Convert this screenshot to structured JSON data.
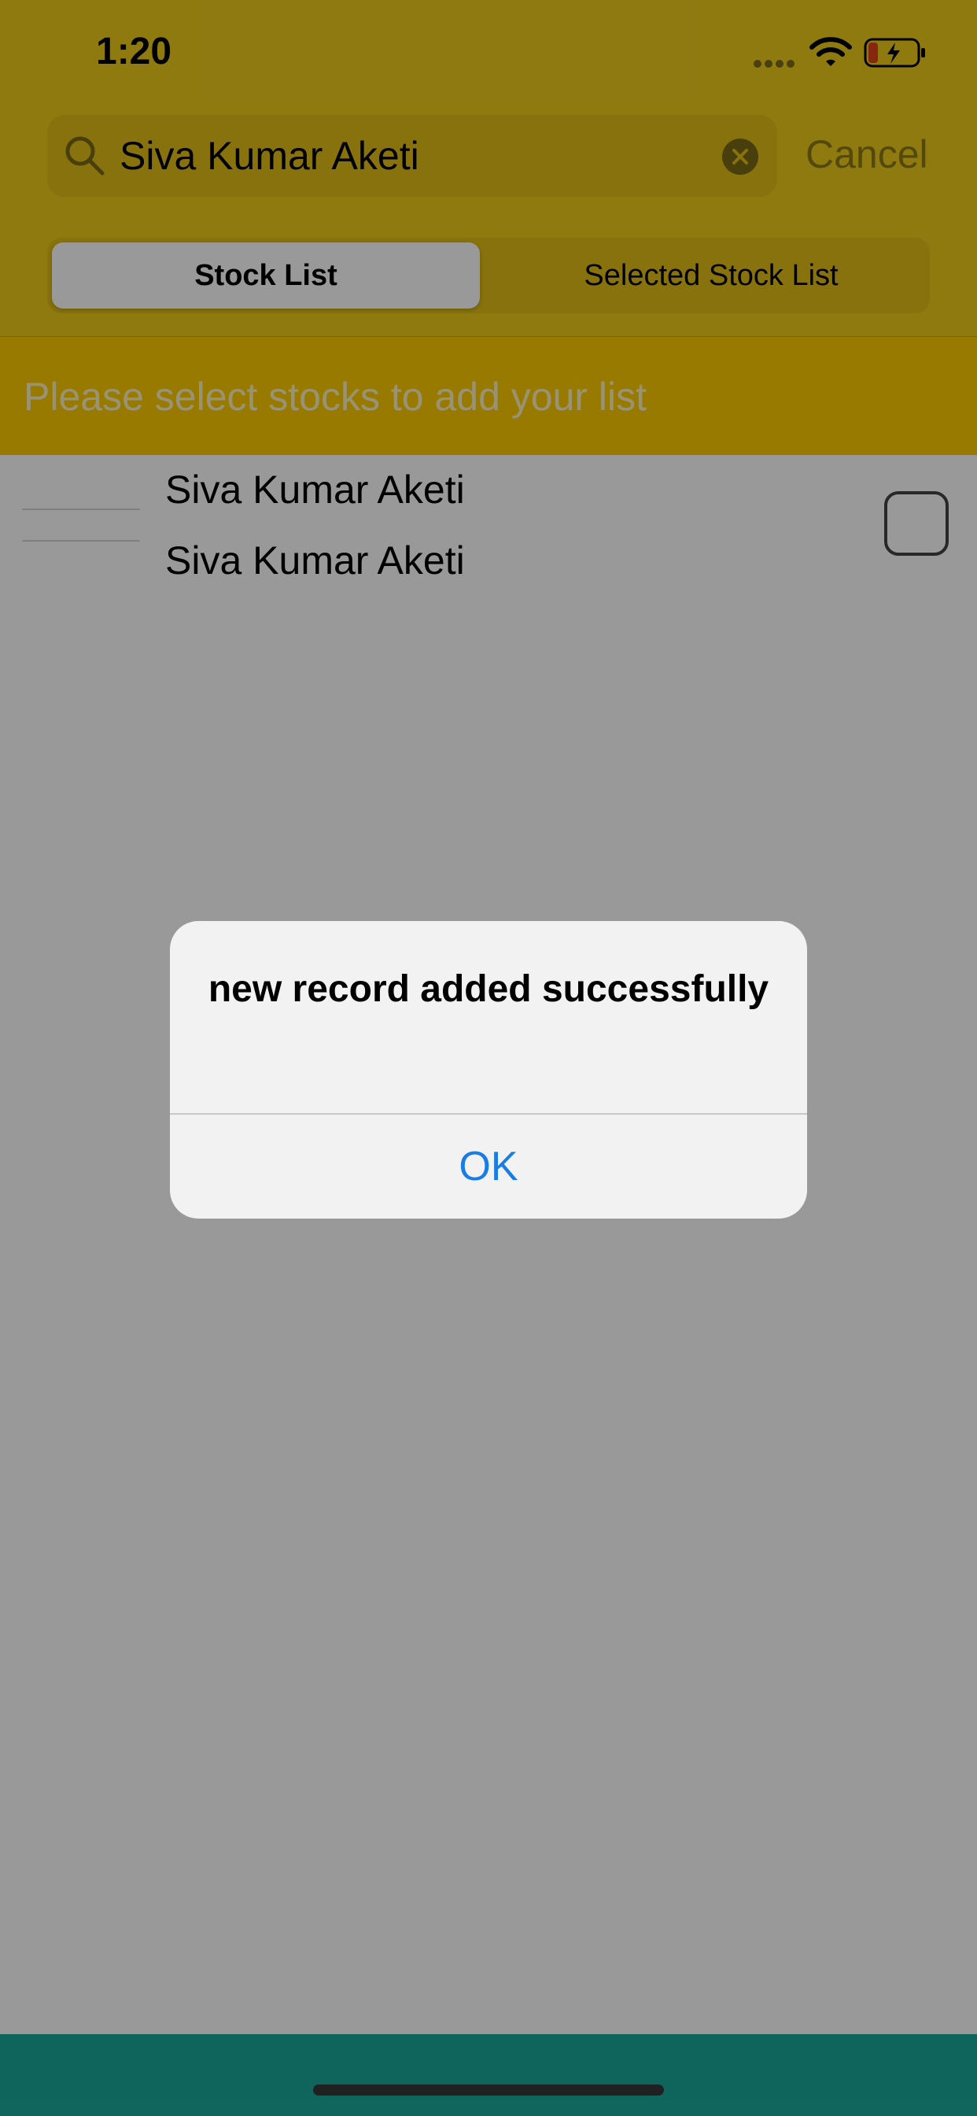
{
  "status_bar": {
    "time": "1:20"
  },
  "search": {
    "query": "Siva Kumar Aketi",
    "cancel_label": "Cancel"
  },
  "segments": {
    "items": [
      "Stock List",
      "Selected Stock List"
    ],
    "selected": "Stock List"
  },
  "prompt": "Please select stocks to add your list",
  "list": {
    "rows": [
      {
        "title": "Siva Kumar Aketi",
        "subtitle": "Siva Kumar Aketi",
        "checked": false
      }
    ]
  },
  "alert": {
    "message": "new record added successfully",
    "button_label": "OK"
  },
  "colors": {
    "header_yellow": "#efcc1c",
    "prompt_yellow": "#ffcc00",
    "bottom_bar_teal": "#1aa99a",
    "alert_button_blue": "#1a7de3"
  }
}
